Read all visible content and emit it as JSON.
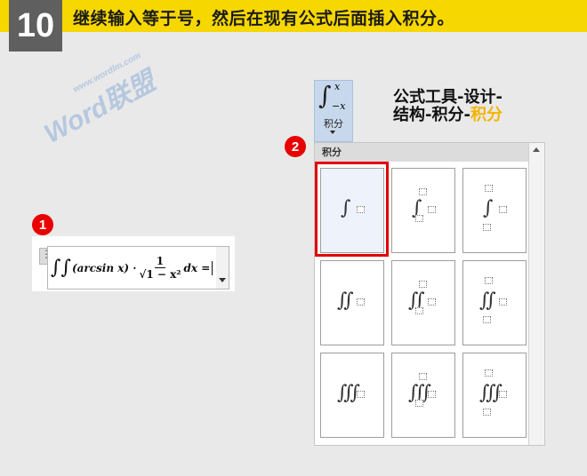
{
  "banner": {
    "step_number": "10",
    "instruction": "继续输入等于号，然后在现有公式后面插入积分。"
  },
  "watermark": {
    "brand": "Word联盟",
    "url": "www.wordlm.com"
  },
  "markers": {
    "one": "1",
    "two": "2"
  },
  "equation": {
    "integrals": "∫∫",
    "func": "(arcsin x) ·",
    "frac_num": "1",
    "frac_den": "√1 − x²",
    "tail": "dx ="
  },
  "ribbon_button": {
    "symbol": "∫",
    "upper": "x",
    "lower": "−x",
    "label": "积分"
  },
  "annotation": {
    "line1": "公式工具-设计-",
    "line2_main": "结构-积分-",
    "line2_highlight": "积分"
  },
  "gallery": {
    "title": "积分",
    "items": [
      {
        "name": "integral"
      },
      {
        "name": "integral-with-stacked-limits"
      },
      {
        "name": "integral-with-limits"
      },
      {
        "name": "double-integral"
      },
      {
        "name": "double-integral-with-stacked-limits"
      },
      {
        "name": "double-integral-with-limits"
      },
      {
        "name": "triple-integral"
      },
      {
        "name": "triple-integral-with-stacked-limits"
      },
      {
        "name": "triple-integral-with-limits"
      }
    ],
    "selected_index": 0
  },
  "colors": {
    "banner": "#f7d700",
    "step_box": "#5f5f5f",
    "badge": "#e80000",
    "highlight": "#f4b400",
    "selection": "#e10000"
  }
}
